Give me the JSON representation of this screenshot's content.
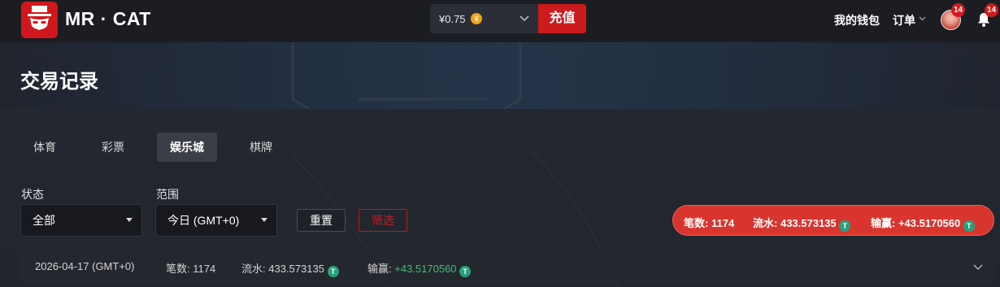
{
  "header": {
    "brand": "MR · CAT",
    "balance": "¥0.75",
    "coin_symbol": "¥",
    "recharge_label": "充值",
    "wallet_label": "我的钱包",
    "orders_label": "订单",
    "avatar_badge": "14",
    "notification_badge": "14"
  },
  "page": {
    "title": "交易记录"
  },
  "tabs": [
    {
      "label": "体育",
      "active": false
    },
    {
      "label": "彩票",
      "active": false
    },
    {
      "label": "娱乐城",
      "active": true
    },
    {
      "label": "棋牌",
      "active": false
    }
  ],
  "filters": {
    "status_label": "状态",
    "status_value": "全部",
    "range_label": "范围",
    "range_value": "今日 (GMT+0)",
    "reset_label": "重置",
    "filter_label": "筛选"
  },
  "summary": {
    "count_label": "笔数:",
    "count_value": "1174",
    "turnover_label": "流水:",
    "turnover_value": "433.573135",
    "winloss_label": "输赢:",
    "winloss_value": "+43.5170560",
    "currency_symbol": "T"
  },
  "record_row": {
    "date": "2026-04-17 (GMT+0)",
    "count_label": "笔数:",
    "count_value": "1174",
    "turnover_label": "流水:",
    "turnover_value": "433.573135",
    "winloss_label": "输赢:",
    "winloss_value": "+43.5170560"
  },
  "colors": {
    "accent_red": "#cd1a1c",
    "positive_green": "#3bc07a",
    "tether_green": "#26a17b",
    "coin_gold": "#f3a316"
  }
}
